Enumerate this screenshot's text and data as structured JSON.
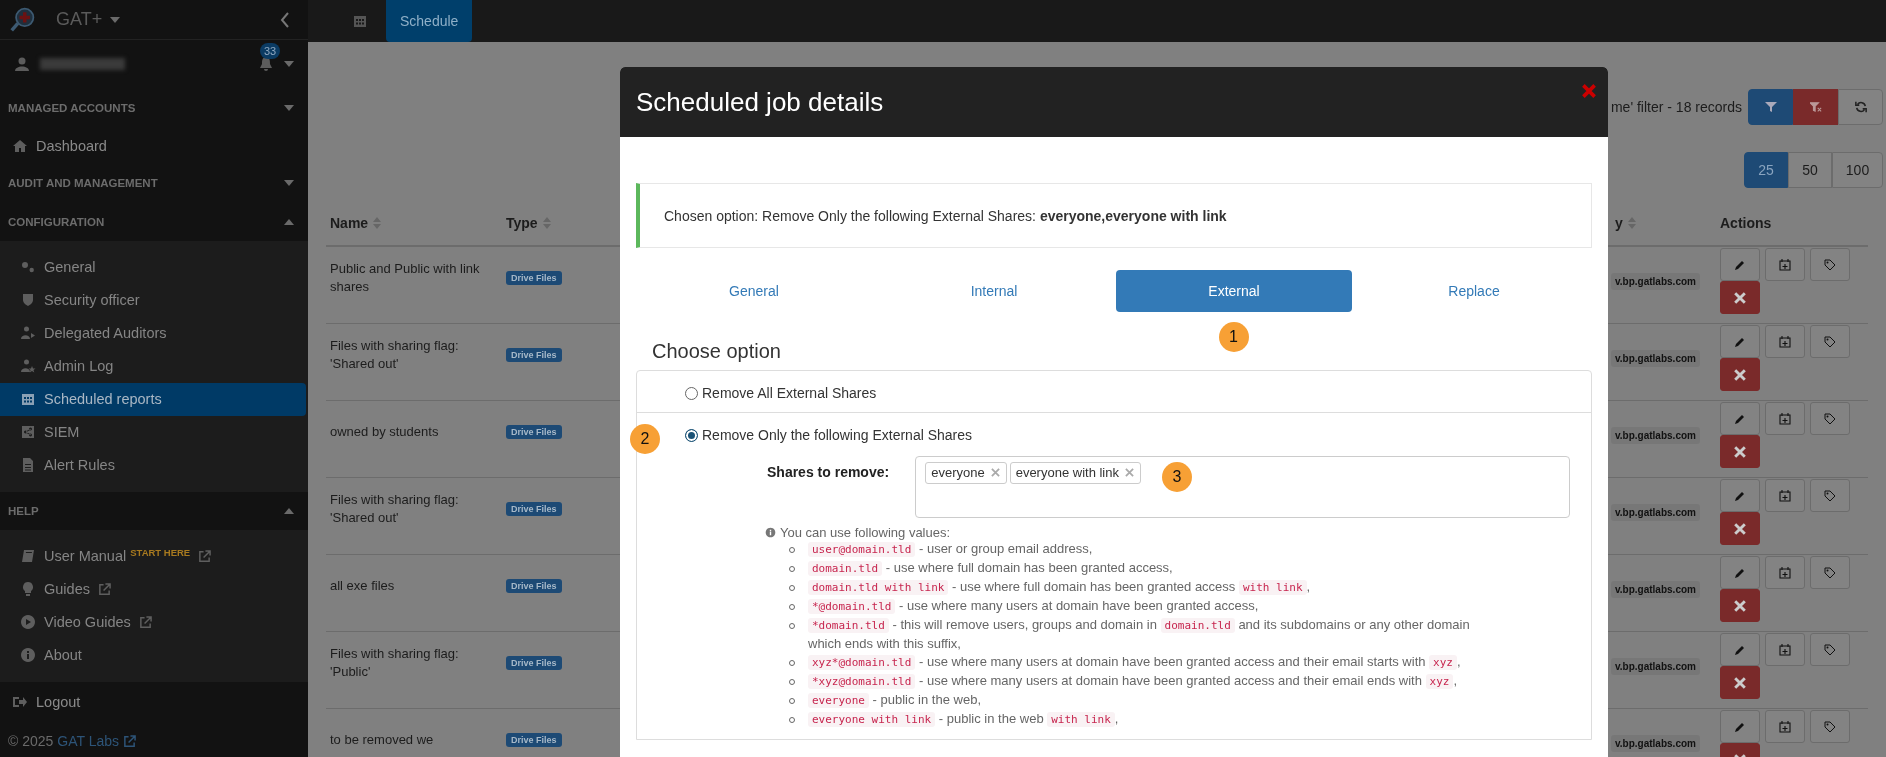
{
  "sidebar": {
    "brand": "GAT+",
    "notifications": "33",
    "menu": [
      {
        "kind": "section",
        "title": "MANAGED ACCOUNTS",
        "expanded": false
      },
      {
        "kind": "link",
        "label": "Dashboard",
        "selected": false
      },
      {
        "kind": "section",
        "title": "AUDIT AND MANAGEMENT",
        "expanded": false
      },
      {
        "kind": "section",
        "title": "CONFIGURATION",
        "expanded": true
      },
      {
        "kind": "group",
        "items": [
          {
            "label": "General",
            "selected": false,
            "external": false
          },
          {
            "label": "Security officer",
            "selected": false,
            "external": false
          },
          {
            "label": "Delegated Auditors",
            "selected": false,
            "external": false
          },
          {
            "label": "Admin Log",
            "selected": false,
            "external": false
          },
          {
            "label": "Scheduled reports",
            "selected": true,
            "external": false
          },
          {
            "label": "SIEM",
            "selected": false,
            "external": false
          },
          {
            "label": "Alert Rules",
            "selected": false,
            "external": false
          }
        ]
      },
      {
        "kind": "section",
        "title": "HELP",
        "expanded": true
      },
      {
        "kind": "group",
        "items": [
          {
            "label": "User Manual",
            "badge": "START HERE",
            "selected": false,
            "external": true
          },
          {
            "label": "Guides",
            "selected": false,
            "external": true
          },
          {
            "label": "Video Guides",
            "selected": false,
            "external": true
          },
          {
            "label": "About",
            "selected": false,
            "external": false
          }
        ]
      }
    ],
    "logout": "Logout",
    "copyright": "© 2025",
    "company_link": "GAT Labs"
  },
  "topbar": {
    "tabs": [
      {
        "label": "Schedule",
        "selected": true
      }
    ]
  },
  "toolbar": {
    "filter_text": "me' filter -  18 records",
    "page_sizes": [
      {
        "label": "25",
        "selected": true
      },
      {
        "label": "50",
        "selected": false
      },
      {
        "label": "100",
        "selected": false
      }
    ]
  },
  "table": {
    "columns": [
      {
        "label": "Name",
        "sortable": true
      },
      {
        "label": "Type",
        "sortable": true
      },
      {
        "label": "y",
        "sortable": true
      },
      {
        "label": "Actions",
        "sortable": false
      }
    ],
    "rows": [
      {
        "name": "Public and Public with link shares",
        "type": "Drive Files",
        "column_3": "v.bp.gatlabs.com"
      },
      {
        "name": "Files with sharing flag: 'Shared out'",
        "type": "Drive Files",
        "column_3": "v.bp.gatlabs.com"
      },
      {
        "name": "owned by students",
        "type": "Drive Files",
        "column_3": "v.bp.gatlabs.com"
      },
      {
        "name": "Files with sharing flag: 'Shared out'",
        "type": "Drive Files",
        "column_3": "v.bp.gatlabs.com"
      },
      {
        "name": "all exe files",
        "type": "Drive Files",
        "column_3": "v.bp.gatlabs.com"
      },
      {
        "name": "Files with sharing flag: 'Public'",
        "type": "Drive Files",
        "column_3": "v.bp.gatlabs.com"
      },
      {
        "name": "to be removed we",
        "type": "Drive Files",
        "column_3": "v.bp.gatlabs.com"
      }
    ]
  },
  "modal": {
    "title": "Scheduled job details",
    "alert": "Chosen option: Remove Only the following External Shares: **everyone,everyone with link**",
    "tabs": [
      {
        "label": "General",
        "selected": false
      },
      {
        "label": "Internal",
        "selected": false
      },
      {
        "label": "External",
        "selected": true
      },
      {
        "label": "Replace",
        "selected": false
      }
    ],
    "tab_marker": "1",
    "heading": "Choose option",
    "options": [
      {
        "label": "Remove All External Shares",
        "selected": false
      },
      {
        "label": "Remove Only the following External Shares",
        "selected": true
      }
    ],
    "option_marker": "2",
    "shares_label": "Shares to remove:",
    "tags": [
      "everyone",
      "everyone with link"
    ],
    "tags_marker": "3",
    "help_title": "You can use following values:",
    "help_items": [
      [
        {
          "kind": "code",
          "text": "user@domain.tld"
        },
        {
          "kind": "text",
          "text": " - user or group email address,"
        }
      ],
      [
        {
          "kind": "code",
          "text": "domain.tld"
        },
        {
          "kind": "text",
          "text": " - use where full domain has been granted access,"
        }
      ],
      [
        {
          "kind": "code",
          "text": "domain.tld with link"
        },
        {
          "kind": "text",
          "text": " - use where full domain has been granted access "
        },
        {
          "kind": "code",
          "text": "with link"
        },
        {
          "kind": "text",
          "text": ","
        }
      ],
      [
        {
          "kind": "code",
          "text": "*@domain.tld"
        },
        {
          "kind": "text",
          "text": " - use where many users at domain have been granted access,"
        }
      ],
      [
        {
          "kind": "code",
          "text": "*domain.tld"
        },
        {
          "kind": "text",
          "text": " - this will remove users, groups and domain in "
        },
        {
          "kind": "code",
          "text": "domain.tld"
        },
        {
          "kind": "text",
          "text": " and its subdomains or any other domain which ends with this suffix,"
        }
      ],
      [
        {
          "kind": "code",
          "text": "xyz*@domain.tld"
        },
        {
          "kind": "text",
          "text": " - use where many users at domain have been granted access and their email starts with "
        },
        {
          "kind": "code",
          "text": "xyz"
        },
        {
          "kind": "text",
          "text": ","
        }
      ],
      [
        {
          "kind": "code",
          "text": "*xyz@domain.tld"
        },
        {
          "kind": "text",
          "text": " - use where many users at domain have been granted access and their email ends with "
        },
        {
          "kind": "code",
          "text": "xyz"
        },
        {
          "kind": "text",
          "text": ","
        }
      ],
      [
        {
          "kind": "code",
          "text": "everyone"
        },
        {
          "kind": "text",
          "text": " - public in the web,"
        }
      ],
      [
        {
          "kind": "code",
          "text": "everyone with link"
        },
        {
          "kind": "text",
          "text": " - public in the web "
        },
        {
          "kind": "code",
          "text": "with link"
        },
        {
          "kind": "text",
          "text": ","
        }
      ]
    ]
  }
}
